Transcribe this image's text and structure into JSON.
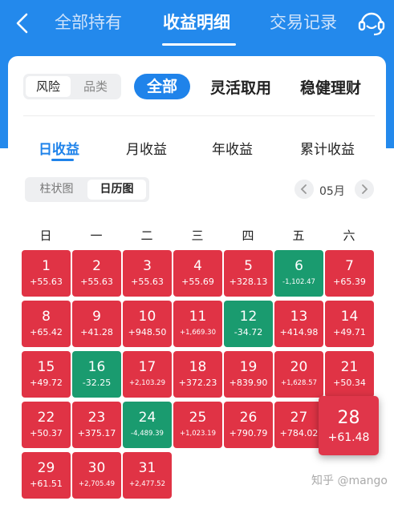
{
  "header": {
    "tabs": [
      "全部持有",
      "收益明细",
      "交易记录"
    ],
    "active_tab": "收益明细",
    "back_icon": "chevron-left-icon",
    "service_icon": "customer-service-icon"
  },
  "filters": {
    "risk_toggle": [
      "风险",
      "品类"
    ],
    "categories": [
      "全部",
      "灵活取用",
      "稳健理财"
    ],
    "active_category": "全部"
  },
  "period_tabs": [
    "日收益",
    "月收益",
    "年收益",
    "累计收益"
  ],
  "active_period": "日收益",
  "view_toggle": [
    "柱状图",
    "日历图"
  ],
  "active_view": "日历图",
  "month_label": "05月",
  "weekdays": [
    "日",
    "一",
    "二",
    "三",
    "四",
    "五",
    "六"
  ],
  "days": [
    {
      "day": "1",
      "value": "+55.63",
      "status": "gain"
    },
    {
      "day": "2",
      "value": "+55.63",
      "status": "gain"
    },
    {
      "day": "3",
      "value": "+55.63",
      "status": "gain"
    },
    {
      "day": "4",
      "value": "+55.69",
      "status": "gain"
    },
    {
      "day": "5",
      "value": "+328.13",
      "status": "gain"
    },
    {
      "day": "6",
      "value": "-1,102.47",
      "status": "loss"
    },
    {
      "day": "7",
      "value": "+65.39",
      "status": "gain"
    },
    {
      "day": "8",
      "value": "+65.42",
      "status": "gain"
    },
    {
      "day": "9",
      "value": "+41.28",
      "status": "gain"
    },
    {
      "day": "10",
      "value": "+948.50",
      "status": "gain"
    },
    {
      "day": "11",
      "value": "+1,669.30",
      "status": "gain"
    },
    {
      "day": "12",
      "value": "-34.72",
      "status": "loss"
    },
    {
      "day": "13",
      "value": "+414.98",
      "status": "gain"
    },
    {
      "day": "14",
      "value": "+49.71",
      "status": "gain"
    },
    {
      "day": "15",
      "value": "+49.72",
      "status": "gain"
    },
    {
      "day": "16",
      "value": "-32.25",
      "status": "loss"
    },
    {
      "day": "17",
      "value": "+2,103.29",
      "status": "gain"
    },
    {
      "day": "18",
      "value": "+372.23",
      "status": "gain"
    },
    {
      "day": "19",
      "value": "+839.90",
      "status": "gain"
    },
    {
      "day": "20",
      "value": "+1,628.57",
      "status": "gain"
    },
    {
      "day": "21",
      "value": "+50.34",
      "status": "gain"
    },
    {
      "day": "22",
      "value": "+50.37",
      "status": "gain"
    },
    {
      "day": "23",
      "value": "+375.17",
      "status": "gain"
    },
    {
      "day": "24",
      "value": "-4,489.39",
      "status": "loss"
    },
    {
      "day": "25",
      "value": "+1,023.19",
      "status": "gain"
    },
    {
      "day": "26",
      "value": "+790.79",
      "status": "gain"
    },
    {
      "day": "27",
      "value": "+784.02",
      "status": "gain"
    },
    {
      "day": "28",
      "value": "+61.48",
      "status": "gain",
      "selected": true
    },
    {
      "day": "29",
      "value": "+61.51",
      "status": "gain"
    },
    {
      "day": "30",
      "value": "+2,705.49",
      "status": "gain"
    },
    {
      "day": "31",
      "value": "+2,477.52",
      "status": "gain"
    }
  ],
  "colors": {
    "primary": "#2389ec",
    "gain": "#e03345",
    "loss": "#1a9b6f"
  },
  "watermark": "知乎 @mango"
}
